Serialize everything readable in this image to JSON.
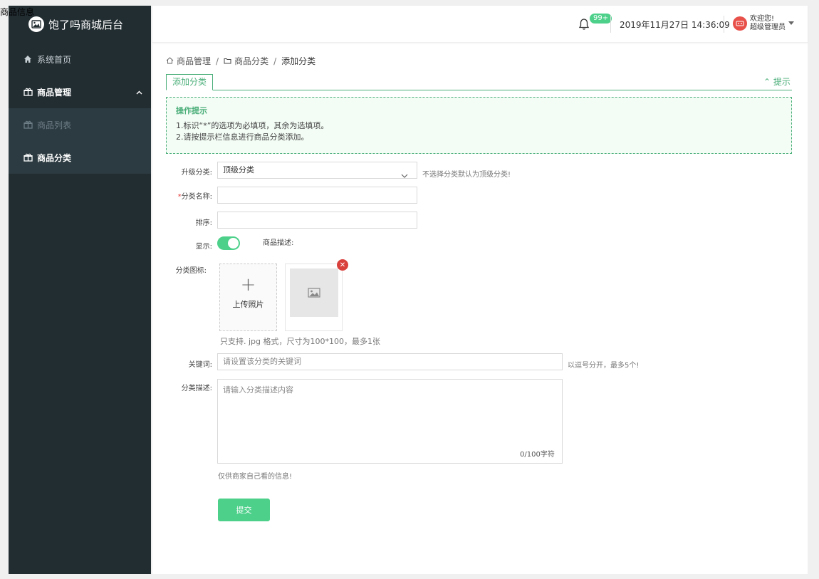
{
  "page_label": "商品信息",
  "app": {
    "title": "饱了吗商城后台"
  },
  "sidebar": {
    "items": [
      {
        "label": "系统首页"
      },
      {
        "label": "商品管理"
      },
      {
        "label": "商品列表"
      },
      {
        "label": "商品分类"
      }
    ]
  },
  "topbar": {
    "badge": "99+",
    "datetime": "2019年11月27日 14:36:09",
    "welcome": "欢迎您!",
    "role": "超级管理员"
  },
  "breadcrumb": [
    "商品管理",
    "商品分类",
    "添加分类"
  ],
  "tab": {
    "label": "添加分类",
    "tip_toggle": "⌃ 提示"
  },
  "tips": {
    "title": "操作提示",
    "line1": "1.标识“*”的选项为必填项，其余为选填项。",
    "line2": "2.请按提示栏信息进行商品分类添加。"
  },
  "form": {
    "parent_label": "升级分类:",
    "parent_value": "顶级分类",
    "parent_hint": "不选择分类默认为顶级分类!",
    "name_required": "*",
    "name_label": "分类名称:",
    "sort_label": "排序:",
    "show_label": "显示:",
    "desc_side_label": "商品描述:",
    "icon_label": "分类图标:",
    "upload_text": "上传照片",
    "upload_hint": "只支持. jpg 格式，尺寸为100*100，最多1张",
    "keyword_label": "关键词:",
    "keyword_placeholder": "请设置该分类的关键词",
    "keyword_hint": "以逗号分开，最多5个!",
    "desc_label": "分类描述:",
    "desc_placeholder": "请输入分类描述内容",
    "desc_counter": "0/100字符",
    "desc_hint": "仅供商家自己看的信息!",
    "submit": "提交"
  }
}
